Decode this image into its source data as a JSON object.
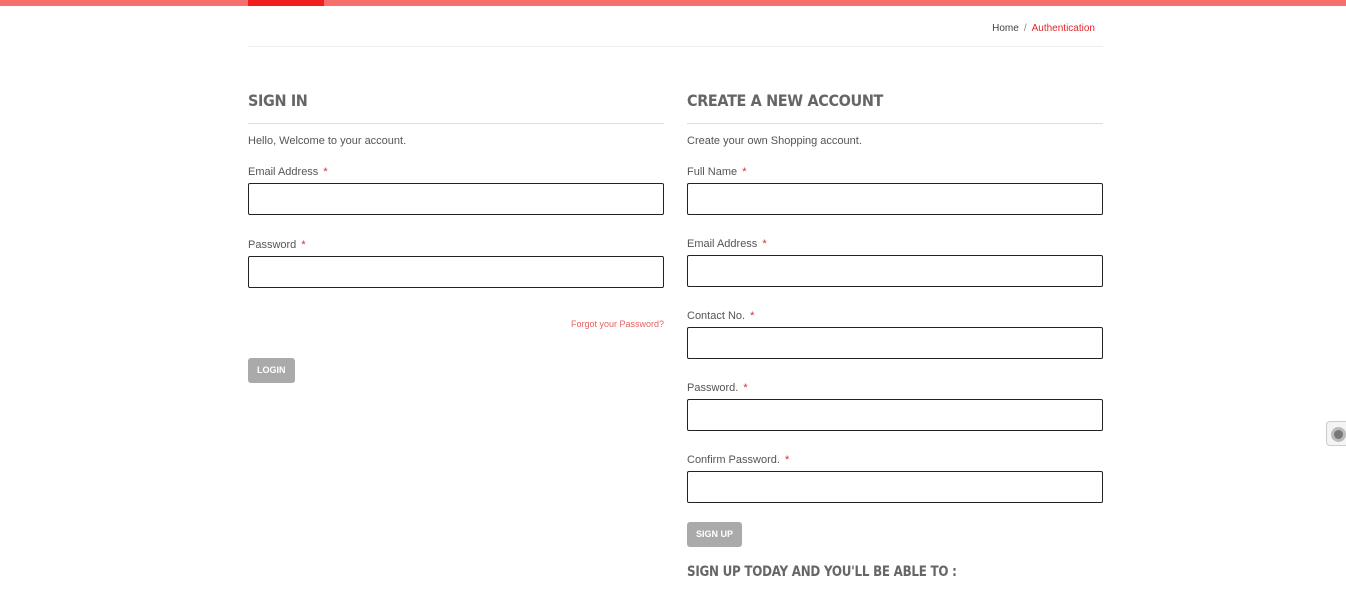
{
  "breadcrumb": {
    "home": "Home",
    "separator": "/",
    "current": "Authentication"
  },
  "signin": {
    "heading": "SIGN IN",
    "intro": "Hello, Welcome to your account.",
    "email_label": "Email Address",
    "email_value": "",
    "password_label": "Password",
    "password_value": "",
    "required_mark": "*",
    "forgot_link": "Forgot your Password?",
    "login_button": "LOGIN"
  },
  "signup": {
    "heading": "CREATE A NEW ACCOUNT",
    "intro": "Create your own Shopping account.",
    "fullname_label": "Full Name",
    "email_label": "Email Address",
    "contact_label": "Contact No.",
    "password_label": "Password.",
    "confirm_label": "Confirm Password.",
    "required_mark": "*",
    "signup_button": "SIGN UP",
    "promo_heading": "SIGN UP TODAY AND YOU'LL BE ABLE TO :"
  },
  "colors": {
    "accent_red": "#f01e1e",
    "top_bar": "#f76e6e",
    "button_gray": "#aaaaaa",
    "link_red": "#e86060"
  }
}
